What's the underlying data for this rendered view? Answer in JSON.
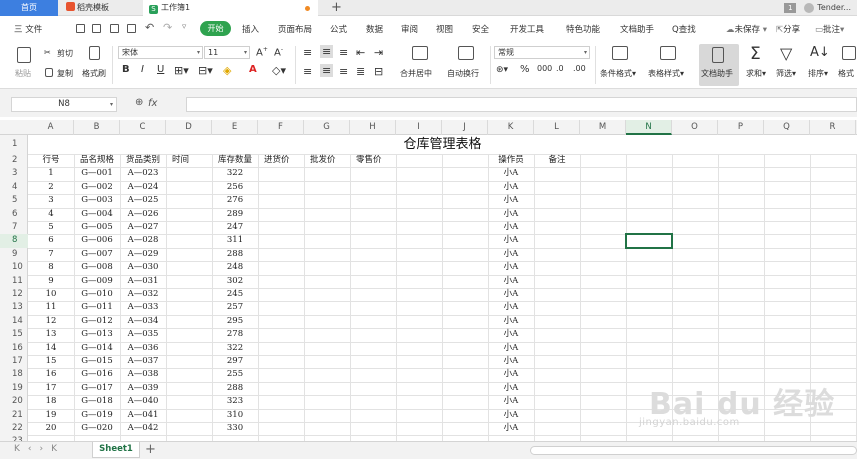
{
  "titlebar": {
    "home_tab": "首页",
    "template_tab": "稻壳模板",
    "workbook_tab": "工作簿1",
    "workbook_icon": "S",
    "new_tab": "+",
    "badge": "1",
    "user": "Tender..."
  },
  "menubar": {
    "file": "三 文件",
    "start": "开始",
    "items": [
      "插入",
      "页面布局",
      "公式",
      "数据",
      "审阅",
      "视图",
      "安全",
      "开发工具",
      "特色功能",
      "文档助手"
    ],
    "search": "Q查找",
    "unsaved": "未保存",
    "share": "分享",
    "comment": "批注"
  },
  "ribbon": {
    "paste": "粘贴",
    "cut": "剪切",
    "copy": "复制",
    "format_painter": "格式刷",
    "font_name": "宋体",
    "font_size": "11",
    "merge_center": "合并居中",
    "wrap_text": "自动换行",
    "number_format": "常规",
    "conditional_format": "条件格式",
    "table_style": "表格样式",
    "doc_helper": "文档助手",
    "sum": "求和",
    "filter": "筛选",
    "sort": "排序",
    "format": "格式"
  },
  "formula_bar": {
    "name_box": "N8",
    "fx": "fx",
    "content": ""
  },
  "grid": {
    "columns": [
      "A",
      "B",
      "C",
      "D",
      "E",
      "F",
      "G",
      "H",
      "I",
      "J",
      "K",
      "L",
      "M",
      "N",
      "O",
      "P",
      "Q",
      "R"
    ],
    "selected_column": "N",
    "selected_row": 8,
    "row_numbers": [
      1,
      2,
      3,
      4,
      5,
      6,
      7,
      8,
      9,
      10,
      11,
      12,
      13,
      14,
      15,
      16,
      17,
      18,
      19,
      20,
      21,
      22,
      23
    ],
    "title": "仓库管理表格",
    "headers": {
      "A": "行号",
      "B": "品名规格",
      "C": "货品类别",
      "D": "时间",
      "E": "库存数量",
      "F": "进货价",
      "G": "批发价",
      "H": "零售价",
      "K": "操作员",
      "L": "备注"
    },
    "rows": [
      {
        "no": "1",
        "spec": "G—001",
        "cat": "A—023",
        "qty": "322",
        "op": "小A"
      },
      {
        "no": "2",
        "spec": "G—002",
        "cat": "A—024",
        "qty": "256",
        "op": "小A"
      },
      {
        "no": "3",
        "spec": "G—003",
        "cat": "A—025",
        "qty": "276",
        "op": "小A"
      },
      {
        "no": "4",
        "spec": "G—004",
        "cat": "A—026",
        "qty": "289",
        "op": "小A"
      },
      {
        "no": "5",
        "spec": "G—005",
        "cat": "A—027",
        "qty": "247",
        "op": "小A"
      },
      {
        "no": "6",
        "spec": "G—006",
        "cat": "A—028",
        "qty": "311",
        "op": "小A"
      },
      {
        "no": "7",
        "spec": "G—007",
        "cat": "A—029",
        "qty": "288",
        "op": "小A"
      },
      {
        "no": "8",
        "spec": "G—008",
        "cat": "A—030",
        "qty": "248",
        "op": "小A"
      },
      {
        "no": "9",
        "spec": "G—009",
        "cat": "A—031",
        "qty": "302",
        "op": "小A"
      },
      {
        "no": "10",
        "spec": "G—010",
        "cat": "A—032",
        "qty": "245",
        "op": "小A"
      },
      {
        "no": "11",
        "spec": "G—011",
        "cat": "A—033",
        "qty": "257",
        "op": "小A"
      },
      {
        "no": "12",
        "spec": "G—012",
        "cat": "A—034",
        "qty": "295",
        "op": "小A"
      },
      {
        "no": "13",
        "spec": "G—013",
        "cat": "A—035",
        "qty": "278",
        "op": "小A"
      },
      {
        "no": "14",
        "spec": "G—014",
        "cat": "A—036",
        "qty": "322",
        "op": "小A"
      },
      {
        "no": "15",
        "spec": "G—015",
        "cat": "A—037",
        "qty": "297",
        "op": "小A"
      },
      {
        "no": "16",
        "spec": "G—016",
        "cat": "A—038",
        "qty": "255",
        "op": "小A"
      },
      {
        "no": "17",
        "spec": "G—017",
        "cat": "A—039",
        "qty": "288",
        "op": "小A"
      },
      {
        "no": "18",
        "spec": "G—018",
        "cat": "A—040",
        "qty": "323",
        "op": "小A"
      },
      {
        "no": "19",
        "spec": "G—019",
        "cat": "A—041",
        "qty": "310",
        "op": "小A"
      },
      {
        "no": "20",
        "spec": "G—020",
        "cat": "A—042",
        "qty": "330",
        "op": "小A"
      }
    ]
  },
  "sheetbar": {
    "sheet_name": "Sheet1",
    "add": "+"
  },
  "watermark": {
    "line1": "Bai du 经验",
    "line2": "jingyan.baidu.com"
  },
  "colors": {
    "accent_green": "#217346",
    "start_button": "#2fa34f",
    "home_tab": "#3d7fe0"
  }
}
